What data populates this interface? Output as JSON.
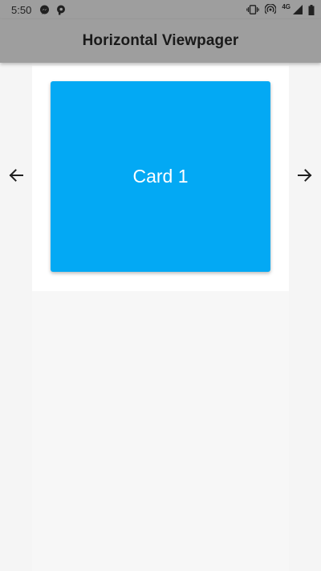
{
  "status_bar": {
    "time": "5:50",
    "left_icons": [
      "messenger-icon",
      "p-app-icon"
    ],
    "right_icons": [
      "vibrate-icon",
      "hotspot-icon",
      "signal-icon",
      "battery-icon"
    ],
    "network_type": "4G"
  },
  "app_bar": {
    "title": "Horizontal Viewpager",
    "background": "#9e9e9e"
  },
  "pager": {
    "prev_icon": "arrow-back-icon",
    "next_icon": "arrow-forward-icon",
    "current_card": {
      "label": "Card 1",
      "color": "#03a9f4"
    }
  }
}
